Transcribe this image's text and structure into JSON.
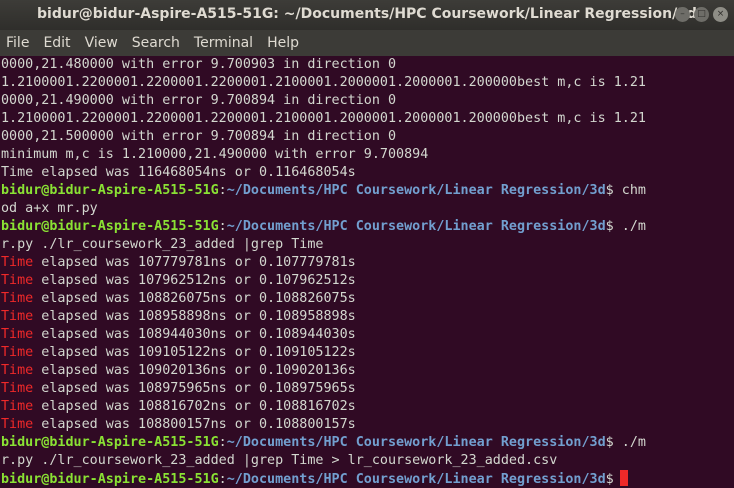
{
  "window": {
    "title": "bidur@bidur-Aspire-A515-51G: ~/Documents/HPC Coursework/Linear Regression/3d",
    "buttons": {
      "minimize": "–",
      "maximize": "□",
      "close": "×"
    }
  },
  "menu": [
    "File",
    "Edit",
    "View",
    "Search",
    "Terminal",
    "Help"
  ],
  "prompt": {
    "user": "bidur@bidur-Aspire-A515-51G",
    "sep": ":",
    "path": "~/Documents/HPC Coursework/Linear Regression/3d",
    "symbol": "$"
  },
  "lines": {
    "l1": "0000,21.480000 with error 9.700903 in direction 0",
    "l2": "1.2100001.2200001.2200001.2200001.2100001.2000001.2000001.200000best m,c is 1.21",
    "l3": "0000,21.490000 with error 9.700894 in direction 0",
    "l4": "1.2100001.2200001.2200001.2200001.2100001.2000001.2000001.200000best m,c is 1.21",
    "l5": "0000,21.500000 with error 9.700894 in direction 0",
    "l6": "minimum m,c is 1.210000,21.490000 with error 9.700894",
    "l7": "Time elapsed was 116468054ns or 0.116468054s",
    "cmd1a": " chm",
    "cmd1b": "od a+x mr.py",
    "cmd2a": " ./m",
    "cmd2b": "r.py ./lr_coursework_23_added |grep Time",
    "cmd3a": " ./m",
    "cmd3b": "r.py ./lr_coursework_23_added |grep Time > lr_coursework_23_added.csv"
  },
  "grep_keyword": "Time",
  "time_results": [
    " elapsed was 107779781ns or 0.107779781s",
    " elapsed was 107962512ns or 0.107962512s",
    " elapsed was 108826075ns or 0.108826075s",
    " elapsed was 108958898ns or 0.108958898s",
    " elapsed was 108944030ns or 0.108944030s",
    " elapsed was 109105122ns or 0.109105122s",
    " elapsed was 109020136ns or 0.109020136s",
    " elapsed was 108975965ns or 0.108975965s",
    " elapsed was 108816702ns or 0.108816702s",
    " elapsed was 108800157ns or 0.108800157s"
  ],
  "colors": {
    "background": "#300a24",
    "prompt_user": "#8ae234",
    "prompt_path": "#729fcf",
    "grep_match": "#ef2929",
    "cursor": "#ef2929"
  }
}
